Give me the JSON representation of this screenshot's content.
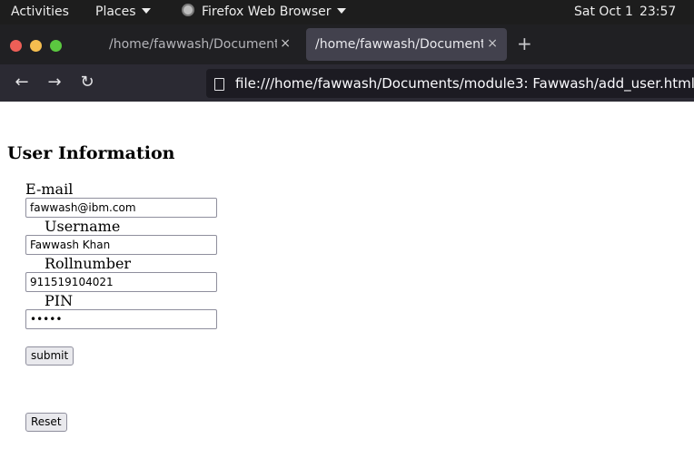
{
  "system_bar": {
    "activities": "Activities",
    "places": "Places",
    "app_name": "Firefox Web Browser",
    "date": "Sat Oct 1",
    "time": "23:57"
  },
  "tabs": [
    {
      "title": "/home/fawwash/Documents",
      "close": "×",
      "active": false
    },
    {
      "title": "/home/fawwash/Documents",
      "close": "×",
      "active": true
    }
  ],
  "new_tab": "+",
  "nav": {
    "back": "←",
    "forward": "→",
    "reload": "↻",
    "url": "file:///home/fawwash/Documents/module3: Fawwash/add_user.html"
  },
  "form": {
    "title": "User Information",
    "email_label": "E-mail",
    "email_value": "fawwash@ibm.com",
    "username_label": "Username",
    "username_value": "Fawwash Khan",
    "roll_label": "Rollnumber",
    "roll_value": "911519104021",
    "pin_label": "PIN",
    "pin_value": "•••••",
    "submit_label": "submit",
    "reset_label": "Reset"
  },
  "colors": {
    "topbar": "#1d1d1d",
    "tabstrip": "#202023",
    "active_tab": "#42414d",
    "navbar": "#2b2a33",
    "urlbar": "#1c1b22"
  }
}
